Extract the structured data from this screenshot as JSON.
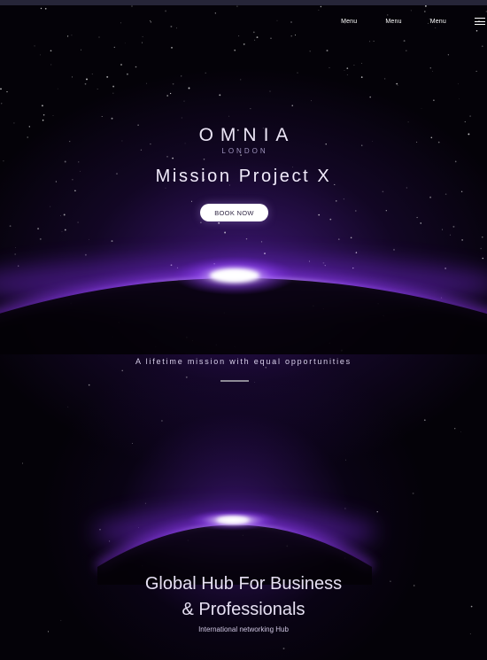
{
  "nav": {
    "items": [
      "Menu",
      "Menu",
      "Menu"
    ],
    "menu_icon": "hamburger-icon"
  },
  "hero": {
    "brand": "OMNIA",
    "brand_sub": "LONDON",
    "title": "Mission Project X",
    "cta": "BOOK NOW"
  },
  "tagline": "A lifetime mission with equal opportunities",
  "hub": {
    "title_line1": "Global Hub For Business",
    "title_line2": "& Professionals",
    "subtitle": "International networking Hub"
  },
  "colors": {
    "background": "#040208",
    "glow": "#7a2cff",
    "text": "#ffffff",
    "button_bg": "#ffffff",
    "button_text": "#332a47"
  }
}
